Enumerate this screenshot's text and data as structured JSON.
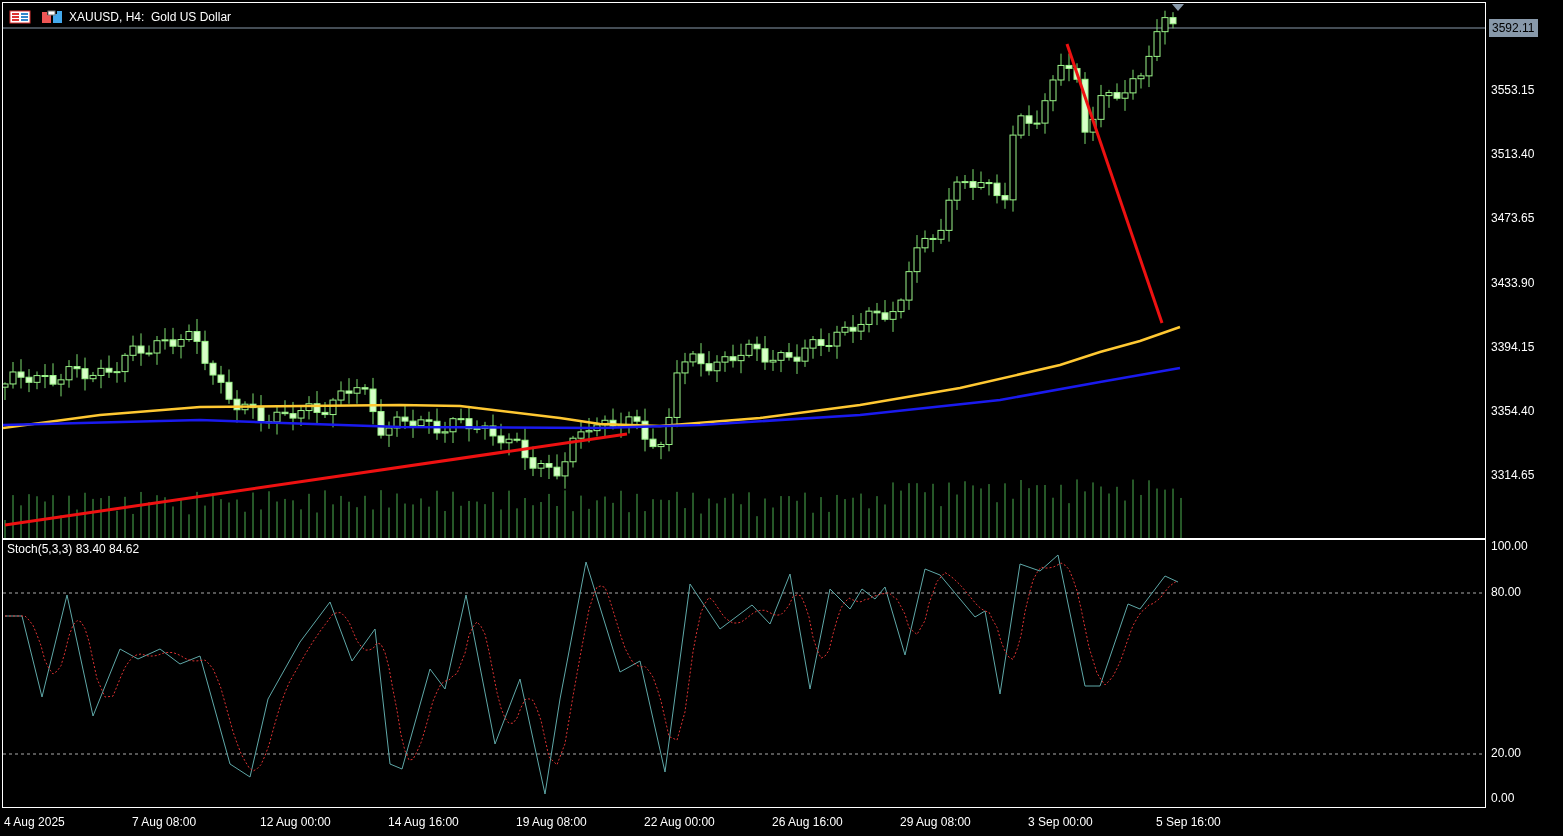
{
  "chart": {
    "title": "XAUUSD, H4:  Gold US Dollar",
    "price_axis": {
      "current_price": "3592.11",
      "ticks": [
        "3553.15",
        "3513.40",
        "3473.65",
        "3433.90",
        "3394.15",
        "3354.40",
        "3314.65"
      ]
    },
    "indicator": {
      "label": "Stoch(5,3,3) 83.40 84.62",
      "ticks": [
        "100.00",
        "80.00",
        "20.00",
        "0.00"
      ]
    },
    "time_axis": [
      "4 Aug 2025",
      "7 Aug 08:00",
      "12 Aug 00:00",
      "14 Aug 16:00",
      "19 Aug 08:00",
      "22 Aug 00:00",
      "26 Aug 16:00",
      "29 Aug 08:00",
      "3 Sep 00:00",
      "5 Sep 16:00"
    ]
  }
}
